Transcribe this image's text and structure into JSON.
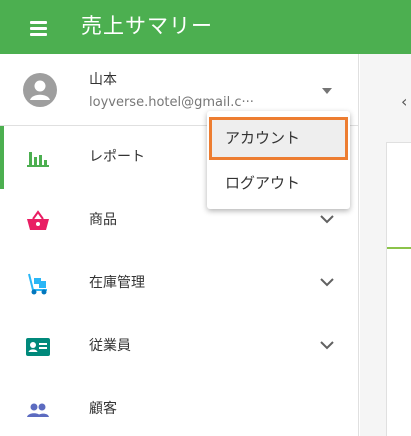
{
  "appbar": {
    "title": "売上サマリー",
    "color": "#4caf50"
  },
  "account": {
    "name": "山本",
    "email": "loyverse.hotel@gmail.c···"
  },
  "nav": [
    {
      "label": "レポート",
      "icon": "bar-chart-icon",
      "active": true
    },
    {
      "label": "商品",
      "icon": "basket-icon"
    },
    {
      "label": "在庫管理",
      "icon": "hand-truck-icon"
    },
    {
      "label": "従業員",
      "icon": "id-card-icon"
    },
    {
      "label": "顧客",
      "icon": "people-icon"
    }
  ],
  "account_menu": [
    {
      "label": "アカウント",
      "highlighted": true
    },
    {
      "label": "ログアウト"
    }
  ],
  "right_panel": {
    "back_glyph": "‹"
  },
  "colors": {
    "accent": "#4caf50",
    "highlight_border": "#ed7d31",
    "basket": "#e91e63",
    "hand_truck": "#29b6f6",
    "id_card": "#00897b",
    "people": "#5c6bc0"
  }
}
